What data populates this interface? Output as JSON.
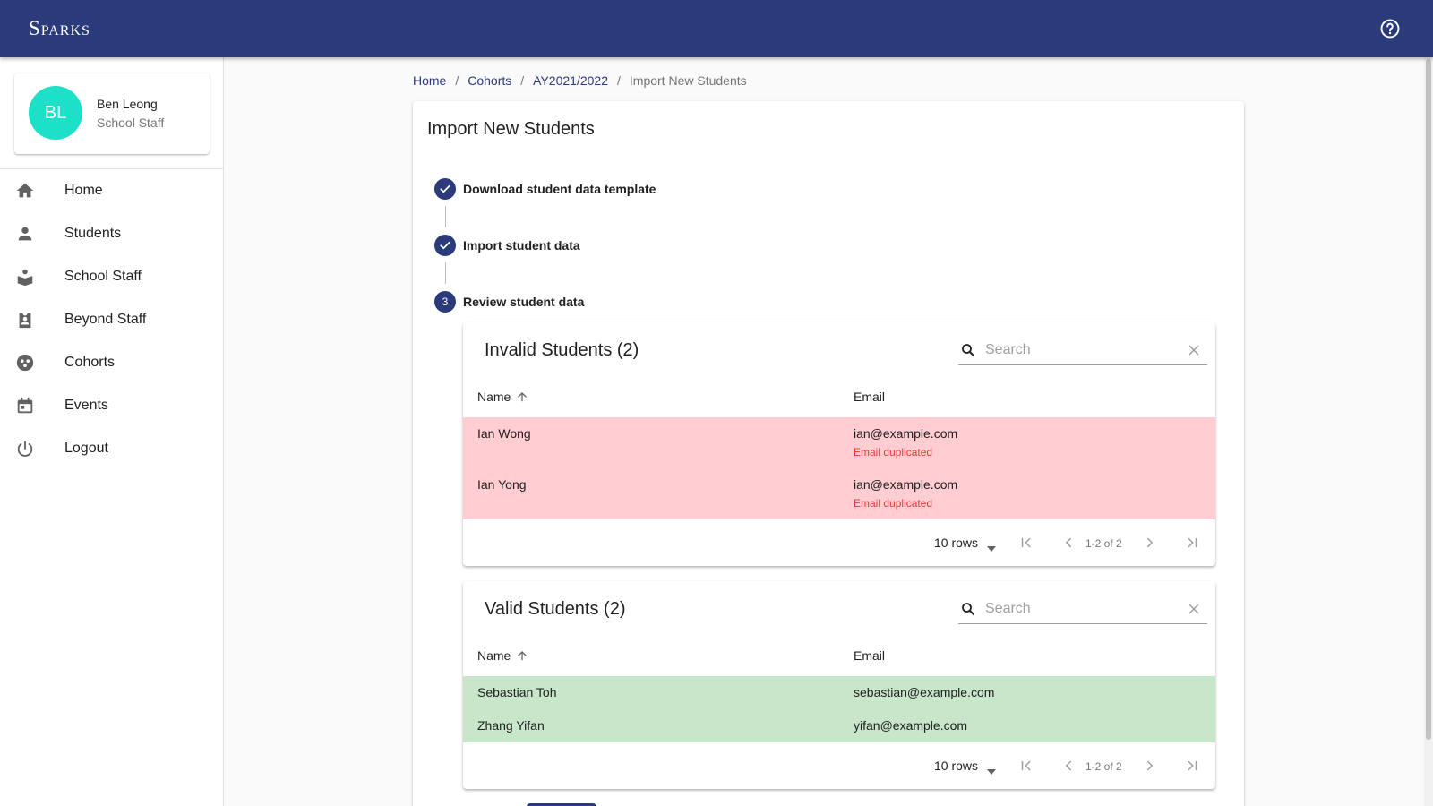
{
  "app": {
    "brand": "Sparks"
  },
  "user": {
    "initials": "BL",
    "name": "Ben Leong",
    "role": "School Staff",
    "avatar_color": "#1de0c9"
  },
  "sidebar": {
    "items": [
      {
        "label": "Home",
        "icon": "home-icon"
      },
      {
        "label": "Students",
        "icon": "person-icon"
      },
      {
        "label": "School Staff",
        "icon": "school-icon"
      },
      {
        "label": "Beyond Staff",
        "icon": "badge-icon"
      },
      {
        "label": "Cohorts",
        "icon": "group-icon"
      },
      {
        "label": "Events",
        "icon": "calendar-icon"
      },
      {
        "label": "Logout",
        "icon": "power-icon"
      }
    ]
  },
  "breadcrumb": {
    "home": "Home",
    "cohorts": "Cohorts",
    "year": "AY2021/2022",
    "current": "Import New Students"
  },
  "page": {
    "title": "Import New Students"
  },
  "stepper": {
    "steps": [
      {
        "label": "Download student data template",
        "state": "completed"
      },
      {
        "label": "Import student data",
        "state": "completed"
      },
      {
        "label": "Review student data",
        "state": "active",
        "number": "3"
      }
    ]
  },
  "invalid_table": {
    "title": "Invalid Students (2)",
    "search_placeholder": "Search",
    "columns": {
      "name": "Name",
      "email": "Email"
    },
    "rows": [
      {
        "name": "Ian Wong",
        "email": "ian@example.com",
        "error": "Email duplicated"
      },
      {
        "name": "Ian Yong",
        "email": "ian@example.com",
        "error": "Email duplicated"
      }
    ],
    "pager": {
      "rows_per_page": "10 rows",
      "range": "1-2 of 2"
    }
  },
  "valid_table": {
    "title": "Valid Students (2)",
    "search_placeholder": "Search",
    "columns": {
      "name": "Name",
      "email": "Email"
    },
    "rows": [
      {
        "name": "Sebastian Toh",
        "email": "sebastian@example.com"
      },
      {
        "name": "Zhang Yifan",
        "email": "yifan@example.com"
      }
    ],
    "pager": {
      "rows_per_page": "10 rows",
      "range": "1-2 of 2"
    }
  },
  "colors": {
    "primary": "#2a3a7a",
    "invalid_row": "#ffcdd2",
    "valid_row": "#c8e6c9",
    "error_text": "#e53935"
  }
}
